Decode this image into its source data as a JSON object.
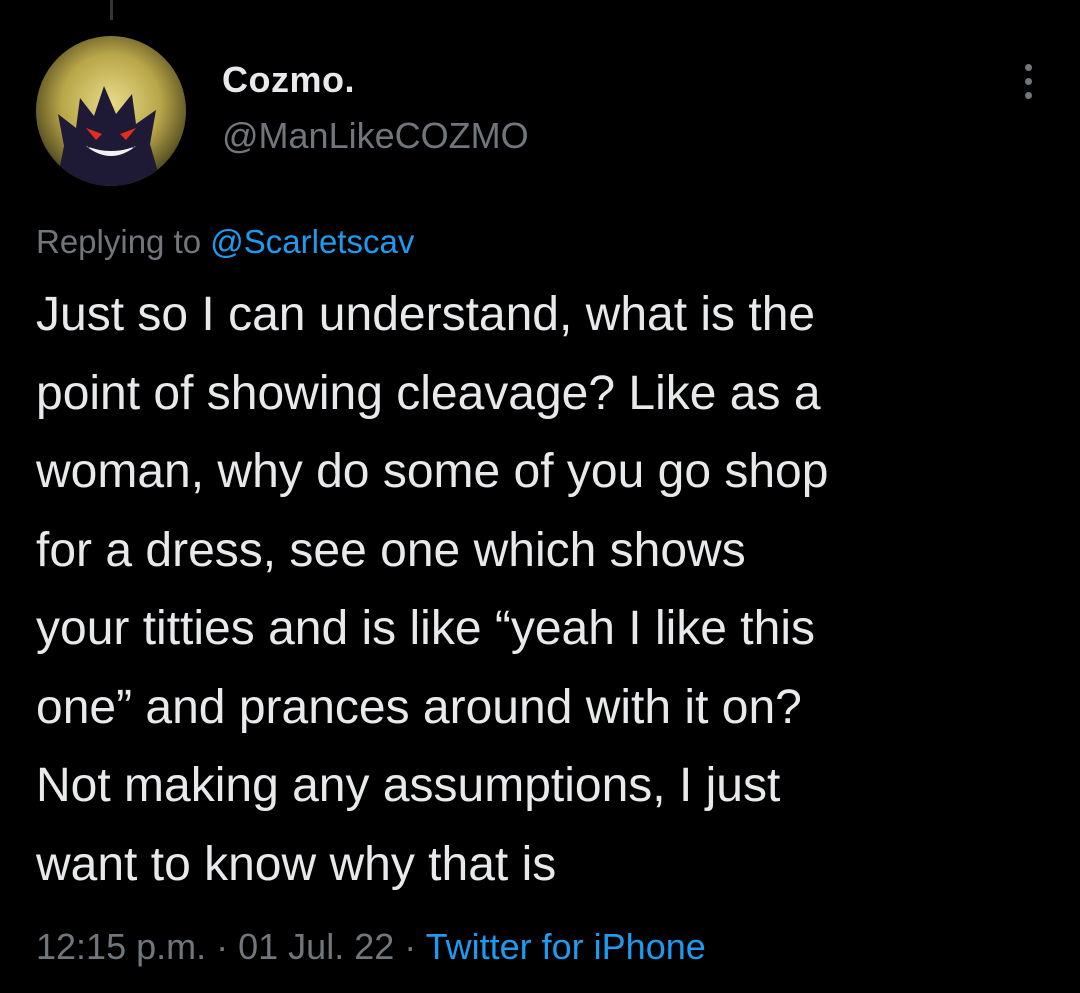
{
  "tweet": {
    "author": {
      "display_name": "Cozmo.",
      "handle": "@ManLikeCOZMO",
      "avatar_icon": "gengar-avatar"
    },
    "reply_prefix": "Replying to ",
    "reply_to": "@Scarletscav",
    "text": "Just so I can understand, what is the\npoint of showing cleavage? Like as a\nwoman, why do some of you go shop\nfor a dress, see one which shows\nyour titties and is like “yeah I like this\none” and prances around with it on?\nNot making any assumptions, I just\nwant to know why that is",
    "time": "12:15 p.m.",
    "separator": "·",
    "date": "01 Jul. 22",
    "source": "Twitter for iPhone"
  },
  "colors": {
    "background": "#000000",
    "text": "#e7e9ea",
    "secondary_text": "#71767b",
    "link": "#1d9bf0"
  }
}
